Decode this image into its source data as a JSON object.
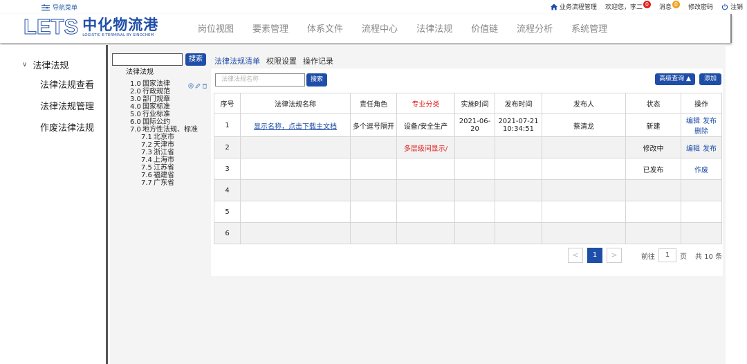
{
  "topbar": {
    "nav_menu_label": "导航菜单",
    "workflow_label": "业务流程管理",
    "welcome": "欢迎您，李二",
    "welcome_badge": "0",
    "messages_label": "消息",
    "messages_badge": "0",
    "change_password": "修改密码",
    "logout": "注销"
  },
  "header": {
    "logo_latin": "LETS",
    "logo_cn": "中化物流港",
    "logo_en": "LOGISTIC E-TERMINAL BY SINOCHEM",
    "nav": [
      "岗位视图",
      "要素管理",
      "体系文件",
      "流程中心",
      "法律法规",
      "价值链",
      "流程分析",
      "系统管理"
    ]
  },
  "sidebar": {
    "title": "法律法规",
    "items": [
      "法律法规查看",
      "法律法规管理",
      "作废法律法规"
    ]
  },
  "tree": {
    "search_button": "搜索",
    "root": "法律法规",
    "nodes": [
      {
        "num": "1.0",
        "label": "国家法律"
      },
      {
        "num": "2.0",
        "label": "行政规范"
      },
      {
        "num": "3.0",
        "label": "部门规章"
      },
      {
        "num": "4.0",
        "label": "国家标准"
      },
      {
        "num": "5.0",
        "label": "行业标准"
      },
      {
        "num": "6.0",
        "label": "国际公约"
      },
      {
        "num": "7.0",
        "label": "地方性法规、标准"
      }
    ],
    "children": [
      {
        "num": "7.1",
        "label": "北京市"
      },
      {
        "num": "7.2",
        "label": "天津市"
      },
      {
        "num": "7.3",
        "label": "浙江省"
      },
      {
        "num": "7.4",
        "label": "上海市"
      },
      {
        "num": "7.5",
        "label": "江苏省"
      },
      {
        "num": "7.6",
        "label": "福建省"
      },
      {
        "num": "7.7",
        "label": "广东省"
      }
    ]
  },
  "tabs": [
    "法律法规清单",
    "权限设置",
    "操作记录"
  ],
  "toolbar": {
    "name_placeholder": "法律法规名称",
    "search_button": "搜索",
    "advanced_button": "高级查询 ▲",
    "add_button": "添加"
  },
  "table": {
    "headers": [
      "序号",
      "法律法规名称",
      "责任角色",
      "专业分类",
      "实施时间",
      "发布时间",
      "发布人",
      "状态",
      "操作"
    ],
    "rows": [
      {
        "idx": "1",
        "name": "显示名称，点击下载主文档",
        "role": "多个逗号隔开",
        "category": "设备/安全生产",
        "impl": "2021-06-20",
        "pub": "2021-07-21 10:34:51",
        "publisher": "蔡清龙",
        "status": "新建",
        "ops": [
          "编辑",
          "发布",
          "删除"
        ]
      },
      {
        "idx": "2",
        "name": "",
        "role": "",
        "category": "多层级间显示/",
        "impl": "",
        "pub": "",
        "publisher": "",
        "status": "修改中",
        "ops": [
          "编辑",
          "发布"
        ]
      },
      {
        "idx": "3",
        "name": "",
        "role": "",
        "category": "",
        "impl": "",
        "pub": "",
        "publisher": "",
        "status": "已发布",
        "ops": [
          "作废"
        ]
      },
      {
        "idx": "4",
        "name": "",
        "role": "",
        "category": "",
        "impl": "",
        "pub": "",
        "publisher": "",
        "status": "",
        "ops": []
      },
      {
        "idx": "5",
        "name": "",
        "role": "",
        "category": "",
        "impl": "",
        "pub": "",
        "publisher": "",
        "status": "",
        "ops": []
      },
      {
        "idx": "6",
        "name": "",
        "role": "",
        "category": "",
        "impl": "",
        "pub": "",
        "publisher": "",
        "status": "",
        "ops": []
      }
    ]
  },
  "pager": {
    "prev": "<",
    "current": "1",
    "next": ">",
    "goto_label": "前往",
    "goto_value": "1",
    "page_unit": "页",
    "total": "共 10 条"
  },
  "colors": {
    "primary": "#1f4ea8",
    "accent_red": "#e02020",
    "badge_orange": "#f0a020"
  }
}
